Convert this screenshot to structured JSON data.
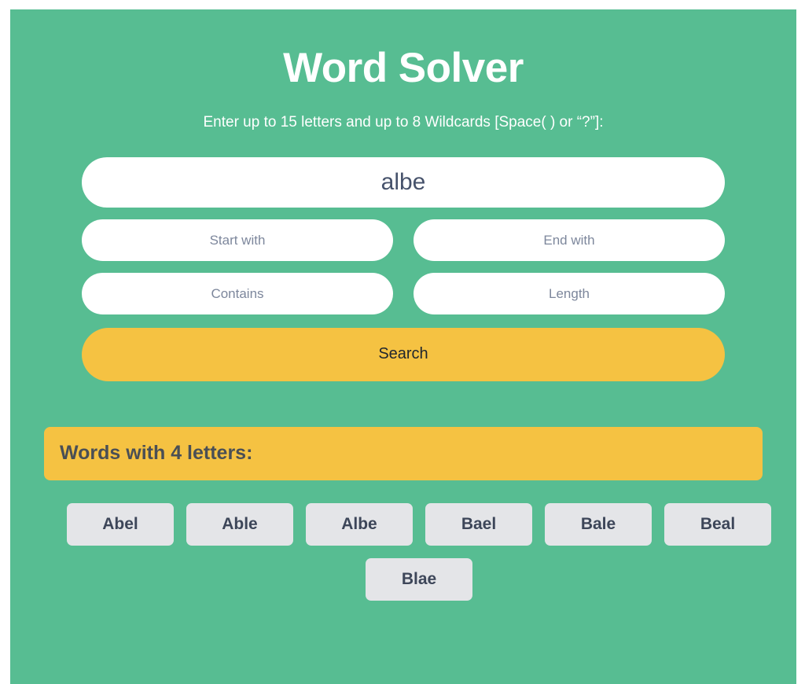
{
  "header": {
    "title": "Word Solver",
    "subtitle": "Enter up to 15 letters and up to 8 Wildcards [Space( ) or “?”]:"
  },
  "form": {
    "letters_input": {
      "value": "albe",
      "placeholder": ""
    },
    "start_with": {
      "value": "",
      "placeholder": "Start with"
    },
    "end_with": {
      "value": "",
      "placeholder": "End with"
    },
    "contains": {
      "value": "",
      "placeholder": "Contains"
    },
    "length": {
      "value": "",
      "placeholder": "Length"
    },
    "search_label": "Search"
  },
  "results": {
    "heading": "Words with 4 letters:",
    "words": [
      "Abel",
      "Able",
      "Albe",
      "Bael",
      "Bale",
      "Beal",
      "Blae"
    ]
  },
  "colors": {
    "background": "#57bd92",
    "accent": "#f5c242",
    "chip": "#e4e5e8",
    "chip_text": "#3d4659",
    "field_text": "#46526b",
    "placeholder": "#7d879c",
    "heading_text": "#4a4f55",
    "title_text": "#ffffff",
    "page": "#ffffff"
  }
}
